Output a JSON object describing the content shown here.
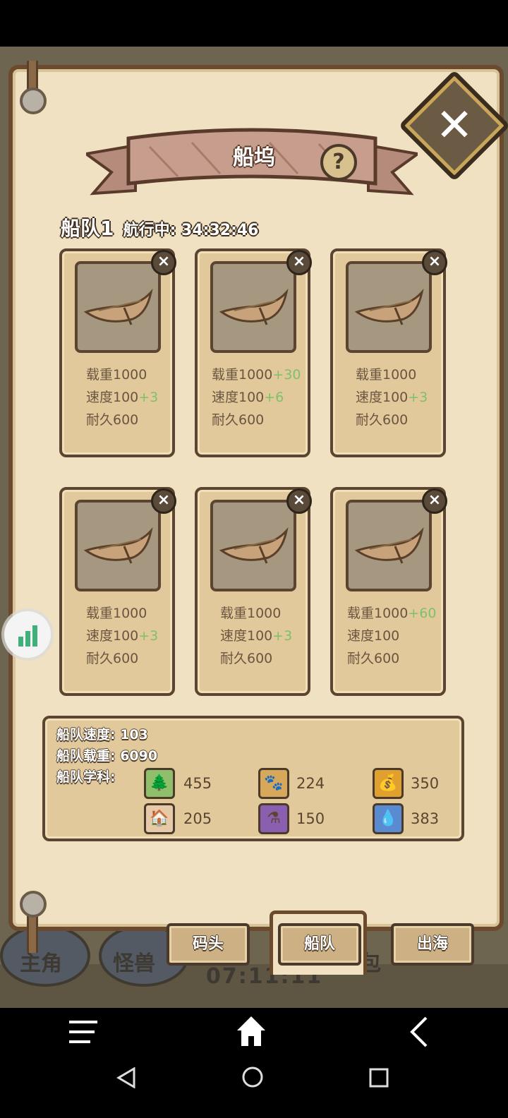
{
  "game": {
    "title": "船坞",
    "help_label": "?",
    "close_label": "✕"
  },
  "fleet": {
    "name": "船队1",
    "status": "航行中: 34:32:46"
  },
  "ships": [
    {
      "capacity": "载重1000",
      "capacity_bonus": "",
      "speed": "速度100",
      "speed_bonus": "+3",
      "durability": "耐久600"
    },
    {
      "capacity": "载重1000",
      "capacity_bonus": "+30",
      "speed": "速度100",
      "speed_bonus": "+6",
      "durability": "耐久600"
    },
    {
      "capacity": "载重1000",
      "capacity_bonus": "",
      "speed": "速度100",
      "speed_bonus": "+3",
      "durability": "耐久600"
    },
    {
      "capacity": "载重1000",
      "capacity_bonus": "",
      "speed": "速度100",
      "speed_bonus": "+3",
      "durability": "耐久600"
    },
    {
      "capacity": "载重1000",
      "capacity_bonus": "",
      "speed": "速度100",
      "speed_bonus": "+3",
      "durability": "耐久600"
    },
    {
      "capacity": "载重1000",
      "capacity_bonus": "+60",
      "speed": "速度100",
      "speed_bonus": "",
      "durability": "耐久600"
    }
  ],
  "summary": {
    "speed": "船队速度: 103",
    "capacity": "船队载重: 6090",
    "disciplines_label": "船队学科:",
    "resources": [
      {
        "icon": "tree-icon",
        "color": "#8fbf6a",
        "value": "455"
      },
      {
        "icon": "paw-icon",
        "color": "#d8a85a",
        "value": "224"
      },
      {
        "icon": "money-bag-icon",
        "color": "#e0a030",
        "value": "350"
      },
      {
        "icon": "house-icon",
        "color": "#e6c9a8",
        "value": "205"
      },
      {
        "icon": "potion-icon",
        "color": "#8a5fb0",
        "value": "150"
      },
      {
        "icon": "water-icon",
        "color": "#5a8ad0",
        "value": "383"
      }
    ]
  },
  "tabs": {
    "dock": "码头",
    "fleet": "船队",
    "sail": "出海"
  },
  "background": {
    "tab_left": "主角",
    "tab_monster": "怪兽",
    "tab_bag": "包",
    "timer": "07:11:11"
  }
}
